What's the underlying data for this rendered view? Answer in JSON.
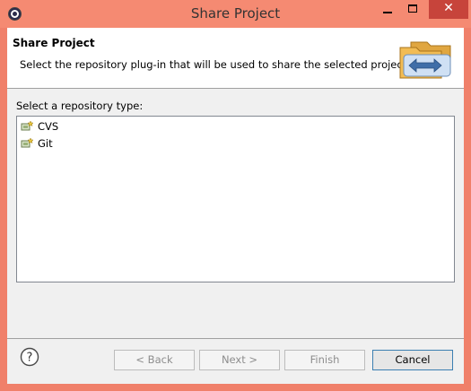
{
  "window": {
    "title": "Share Project"
  },
  "header": {
    "title": "Share Project",
    "description": "Select the repository plug-in that will be used to share the selected project."
  },
  "repository": {
    "label": "Select a repository type:",
    "items": [
      {
        "label": "CVS",
        "icon": "repository-icon"
      },
      {
        "label": "Git",
        "icon": "repository-icon"
      }
    ]
  },
  "buttons": {
    "back": "< Back",
    "next": "Next >",
    "finish": "Finish",
    "cancel": "Cancel"
  },
  "colors": {
    "titlebar": "#f58a72",
    "close_button": "#c7443b",
    "client_bg": "#f0f0f0"
  }
}
